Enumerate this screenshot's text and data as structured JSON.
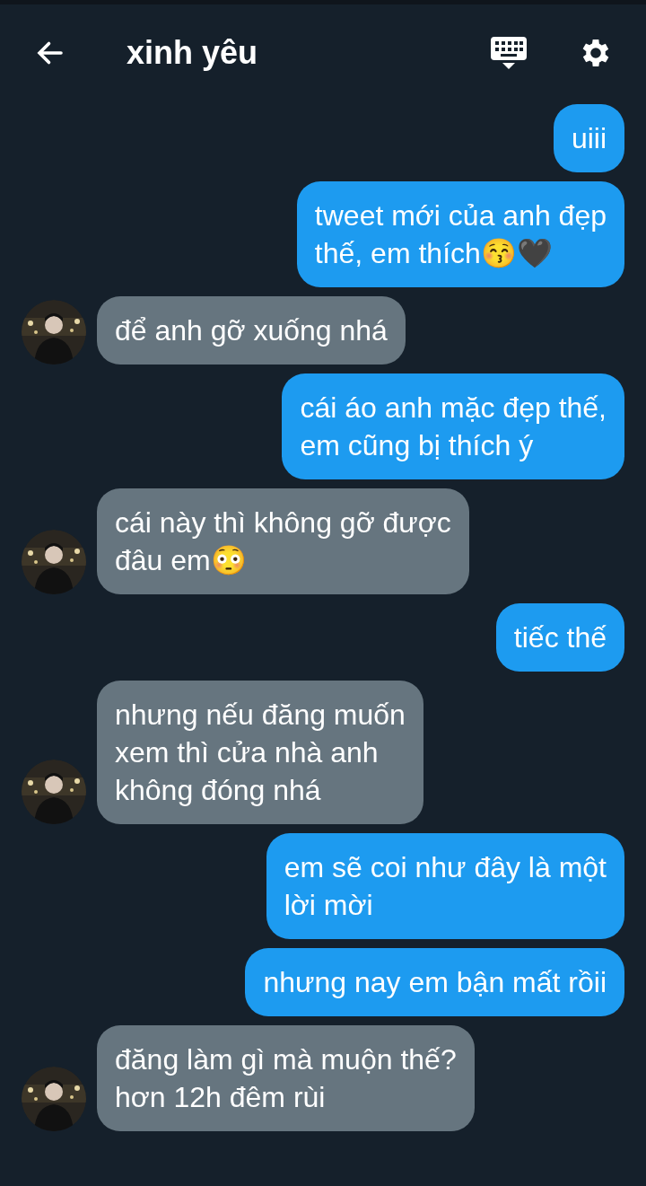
{
  "header": {
    "title": "xinh yêu"
  },
  "messages": [
    {
      "kind": "sent",
      "text": "uiii"
    },
    {
      "kind": "sent",
      "text": "tweet mới của anh đẹp\nthế, em thích😚🖤"
    },
    {
      "kind": "received",
      "text": "để anh gỡ xuống nhá"
    },
    {
      "kind": "sent",
      "text": "cái áo anh mặc đẹp thế,\nem cũng bị thích ý"
    },
    {
      "kind": "received",
      "text": "cái này thì không gỡ được\nđâu em😳"
    },
    {
      "kind": "sent",
      "text": "tiếc thế"
    },
    {
      "kind": "received",
      "text": "nhưng nếu đăng muốn\nxem thì cửa nhà anh\nkhông đóng nhá"
    },
    {
      "kind": "sent",
      "text": "em sẽ coi như đây là một\nlời mời"
    },
    {
      "kind": "sent",
      "text": "nhưng nay em bận mất rồii"
    },
    {
      "kind": "received",
      "text": "đăng làm gì mà muộn thế?\nhơn 12h đêm rùi"
    }
  ]
}
